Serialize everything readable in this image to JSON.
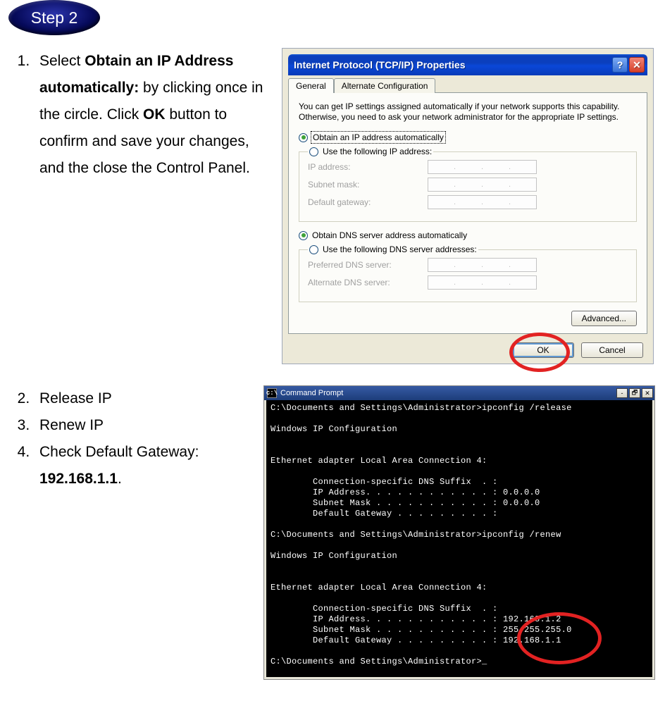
{
  "step_label": "Step 2",
  "instructions": {
    "i1": {
      "n": "1.",
      "pre": "Select ",
      "b1": "Obtain an IP Address automatically:",
      "mid": " by clicking once in the circle. Click ",
      "b2": "OK",
      "post": " button to confirm and save your changes, and the close the Control Panel."
    },
    "i2": {
      "n": "2.",
      "text": "Release IP"
    },
    "i3": {
      "n": "3.",
      "text": "Renew IP"
    },
    "i4": {
      "n": "4.",
      "pre": "Check Default Gateway: ",
      "b": "192.168.1.1",
      "post": "."
    }
  },
  "tcpip_dialog": {
    "title": "Internet Protocol (TCP/IP) Properties",
    "tabs": {
      "general": "General",
      "alt": "Alternate Configuration"
    },
    "help_icon": "?",
    "close_icon": "✕",
    "desc": "You can get IP settings assigned automatically if your network supports this capability. Otherwise, you need to ask your network administrator for the appropriate IP settings.",
    "r_auto_ip": "Obtain an IP address automatically",
    "r_static_ip": "Use the following IP address:",
    "lbl_ip": "IP address:",
    "lbl_mask": "Subnet mask:",
    "lbl_gw": "Default gateway:",
    "r_auto_dns": "Obtain DNS server address automatically",
    "r_static_dns": "Use the following DNS server addresses:",
    "lbl_pdns": "Preferred DNS server:",
    "lbl_adns": "Alternate DNS server:",
    "btn_advanced": "Advanced...",
    "btn_ok": "OK",
    "btn_cancel": "Cancel"
  },
  "cmd": {
    "title": "Command Prompt",
    "min": "-",
    "max": "🗗",
    "close": "✕",
    "line1": "C:\\Documents and Settings\\Administrator>ipconfig /release",
    "line2": "Windows IP Configuration",
    "line3": "Ethernet adapter Local Area Connection 4:",
    "line4": "        Connection-specific DNS Suffix  . :",
    "line5": "        IP Address. . . . . . . . . . . . : 0.0.0.0",
    "line6": "        Subnet Mask . . . . . . . . . . . : 0.0.0.0",
    "line7": "        Default Gateway . . . . . . . . . :",
    "line8": "C:\\Documents and Settings\\Administrator>ipconfig /renew",
    "line9": "Windows IP Configuration",
    "line10": "Ethernet adapter Local Area Connection 4:",
    "line11": "        Connection-specific DNS Suffix  . :",
    "line12": "        IP Address. . . . . . . . . . . . : 192.168.1.2",
    "line13": "        Subnet Mask . . . . . . . . . . . : 255.255.255.0",
    "line14": "        Default Gateway . . . . . . . . . : 192.168.1.1",
    "line15": "C:\\Documents and Settings\\Administrator>_"
  }
}
